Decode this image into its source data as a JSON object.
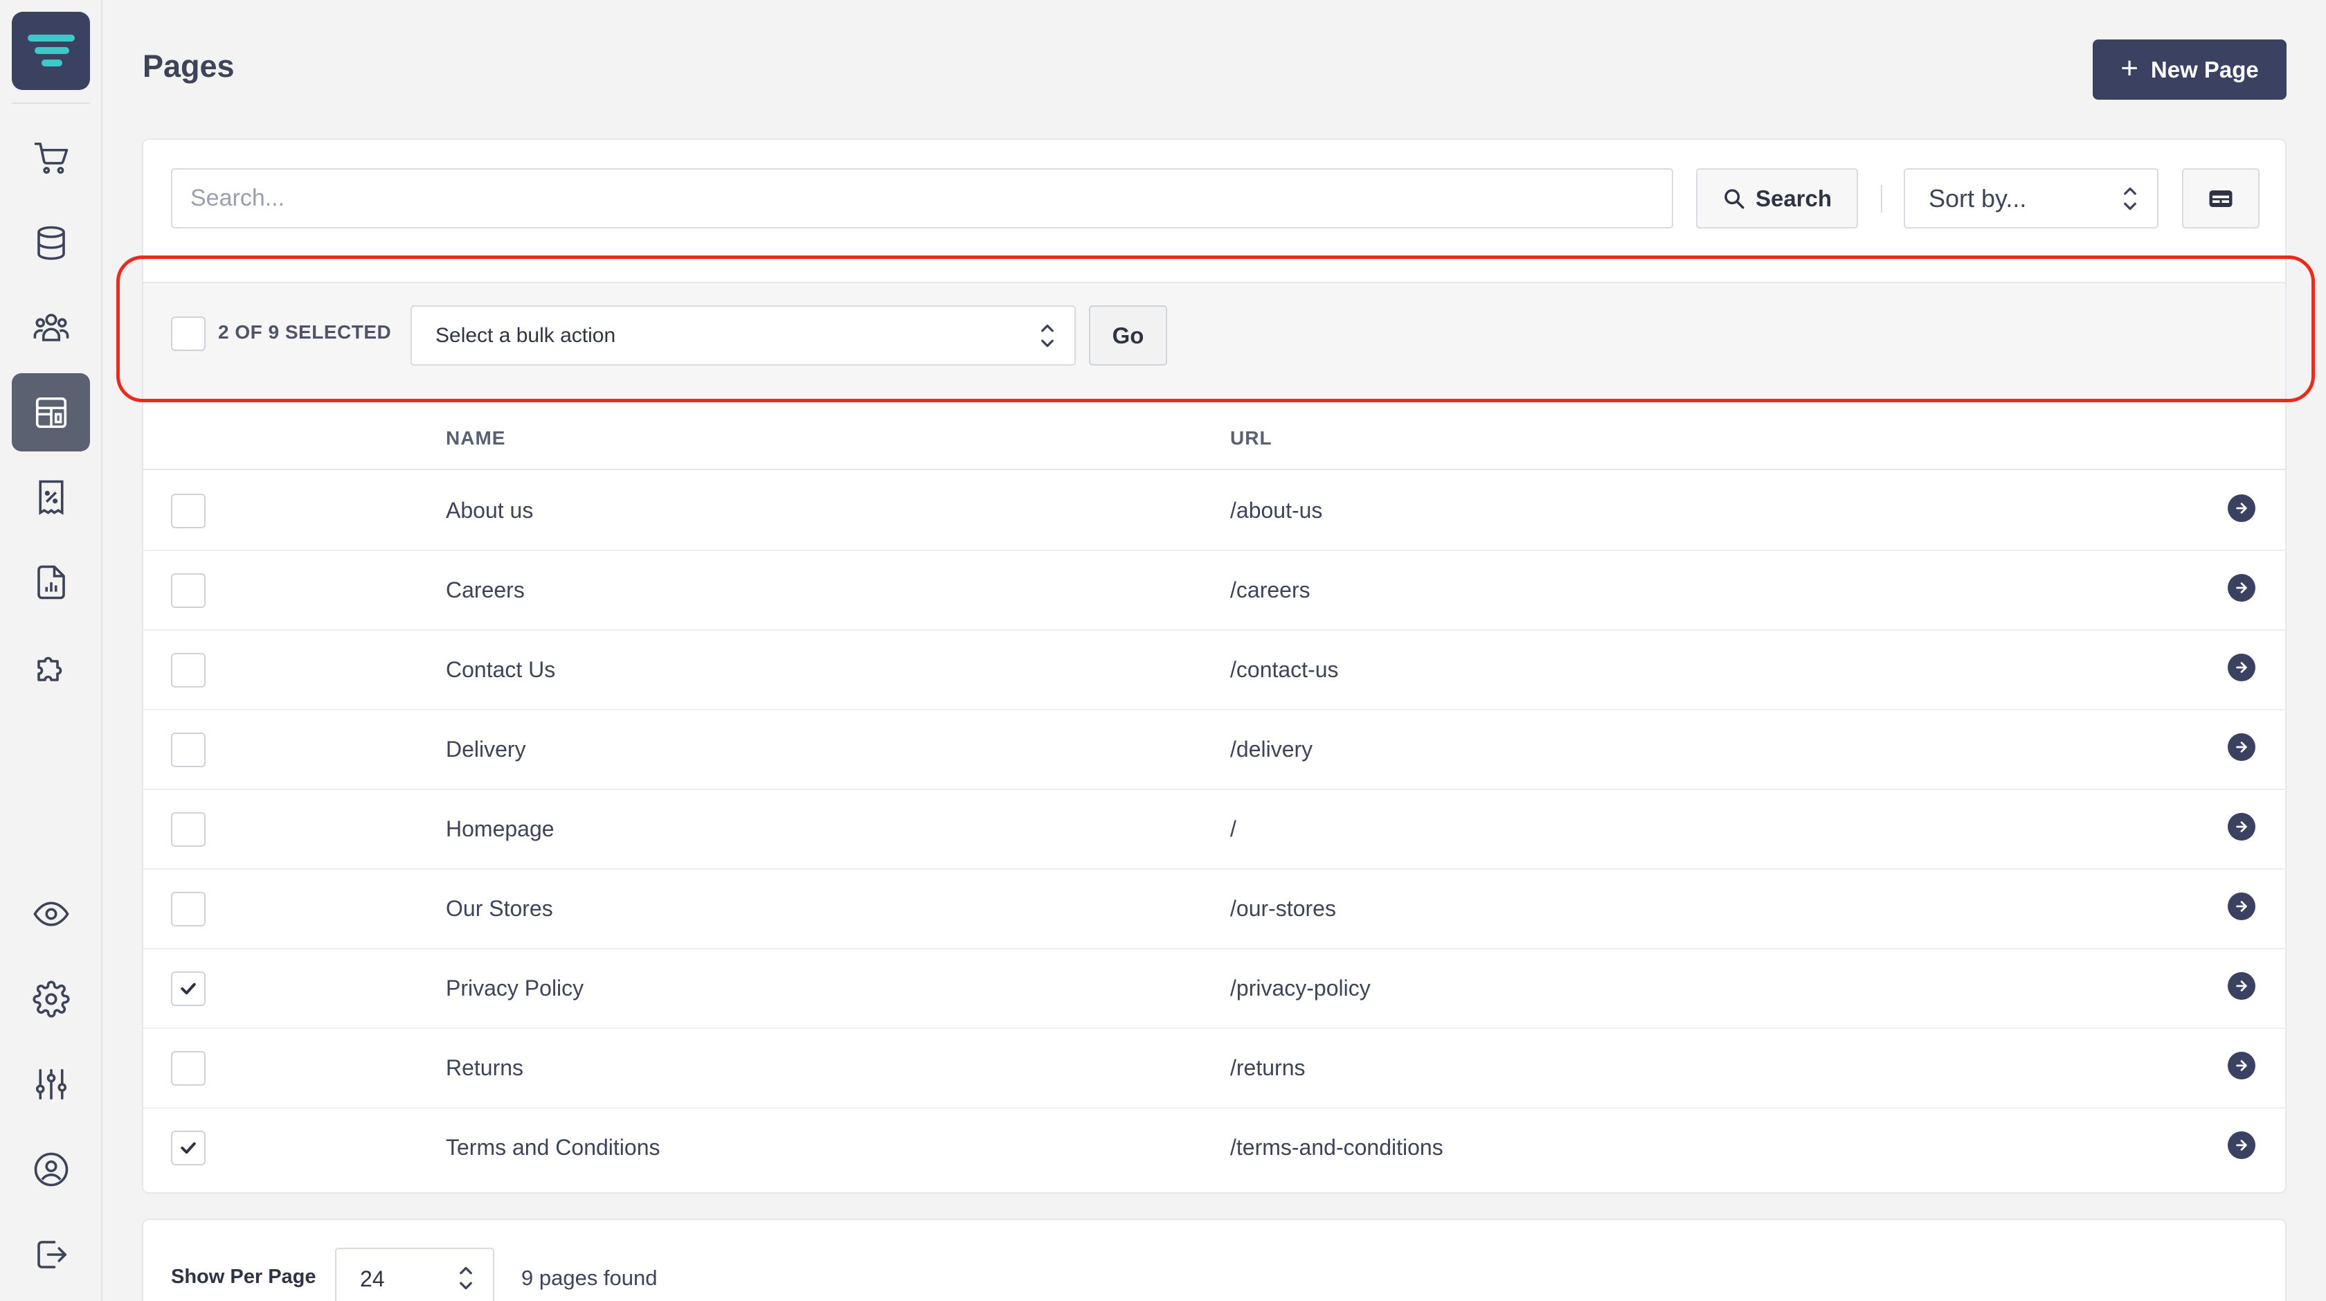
{
  "page": {
    "title": "Pages",
    "new_button_label": "New Page"
  },
  "sidebar": {
    "items": [
      {
        "icon": "cart-icon",
        "active": false
      },
      {
        "icon": "database-icon",
        "active": false
      },
      {
        "icon": "users-icon",
        "active": false
      },
      {
        "icon": "layout-icon",
        "active": true
      },
      {
        "icon": "receipt-percent-icon",
        "active": false
      },
      {
        "icon": "report-icon",
        "active": false
      },
      {
        "icon": "puzzle-icon",
        "active": false
      },
      {
        "icon": "eye-icon",
        "active": false
      },
      {
        "icon": "gear-icon",
        "active": false
      },
      {
        "icon": "sliders-icon",
        "active": false
      },
      {
        "icon": "user-circle-icon",
        "active": false
      },
      {
        "icon": "logout-icon",
        "active": false
      }
    ]
  },
  "toolbar": {
    "search_placeholder": "Search...",
    "search_button": "Search",
    "sort_value": "Sort by..."
  },
  "bulk": {
    "count_text": "2 OF 9 SELECTED",
    "action_value": "Select a bulk action",
    "go_label": "Go"
  },
  "table": {
    "headers": {
      "name": "NAME",
      "url": "URL"
    },
    "rows": [
      {
        "name": "About us",
        "url": "/about-us",
        "checked": false
      },
      {
        "name": "Careers",
        "url": "/careers",
        "checked": false
      },
      {
        "name": "Contact Us",
        "url": "/contact-us",
        "checked": false
      },
      {
        "name": "Delivery",
        "url": "/delivery",
        "checked": false
      },
      {
        "name": "Homepage",
        "url": "/",
        "checked": false
      },
      {
        "name": "Our Stores",
        "url": "/our-stores",
        "checked": false
      },
      {
        "name": "Privacy Policy",
        "url": "/privacy-policy",
        "checked": true
      },
      {
        "name": "Returns",
        "url": "/returns",
        "checked": false
      },
      {
        "name": "Terms and Conditions",
        "url": "/terms-and-conditions",
        "checked": true
      }
    ]
  },
  "footer": {
    "per_page_label": "Show Per Page",
    "per_page_value": "24",
    "found_text": "9 pages found"
  },
  "colors": {
    "accent": "#3a4161",
    "highlight": "#ec2a1c",
    "logo_stripes": "#3fc8c9"
  }
}
